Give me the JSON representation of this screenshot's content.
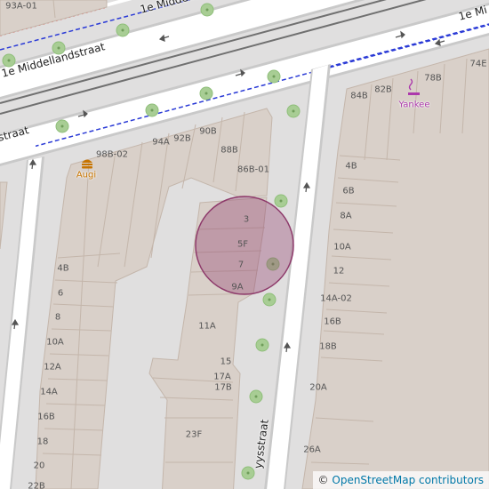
{
  "map": {
    "streets": [
      {
        "id": "middellandstraat-upper",
        "label": "1e Middellandstraat"
      },
      {
        "id": "middellandstraat-lower",
        "label": "1e Middellandstraat"
      },
      {
        "id": "middellandstraat-right",
        "label": "1e Mi"
      },
      {
        "id": "cross-street-left",
        "label": "straat"
      },
      {
        "id": "snellinckstraat",
        "label": "yysstraat"
      }
    ],
    "house_numbers": [
      "93A-01",
      "84B",
      "82B",
      "78B",
      "74E",
      "98B-02",
      "94A",
      "92B",
      "90B",
      "88B",
      "86B-01",
      "3",
      "5F",
      "7",
      "9A",
      "4B",
      "6B",
      "8A",
      "10A",
      "12",
      "14A-02",
      "16B",
      "18B",
      "20A",
      "26A",
      "4B",
      "6",
      "8",
      "10A",
      "12A",
      "14A",
      "16B",
      "18",
      "20",
      "22B",
      "11A",
      "15",
      "17A",
      "17B",
      "23F"
    ],
    "pois": [
      {
        "name": "Augi",
        "icon": "fast-food-icon",
        "color": "#c77400"
      },
      {
        "name": "Yankee",
        "icon": "smoking-shop-icon",
        "color": "#ac39ac"
      }
    ],
    "highlight": {
      "color": "#8e3a6b"
    },
    "colors": {
      "road": "#ffffff",
      "road_casing": "#c9c9c9",
      "background": "#e0dfdf",
      "building": "#d9d0c9",
      "building_outline": "#c4b6ab",
      "bus_route": "#2a3ad6",
      "rail": "#707070",
      "tree": "#a8cd94"
    }
  },
  "attribution": {
    "copy": "©",
    "link_text": "OpenStreetMap contributors"
  }
}
